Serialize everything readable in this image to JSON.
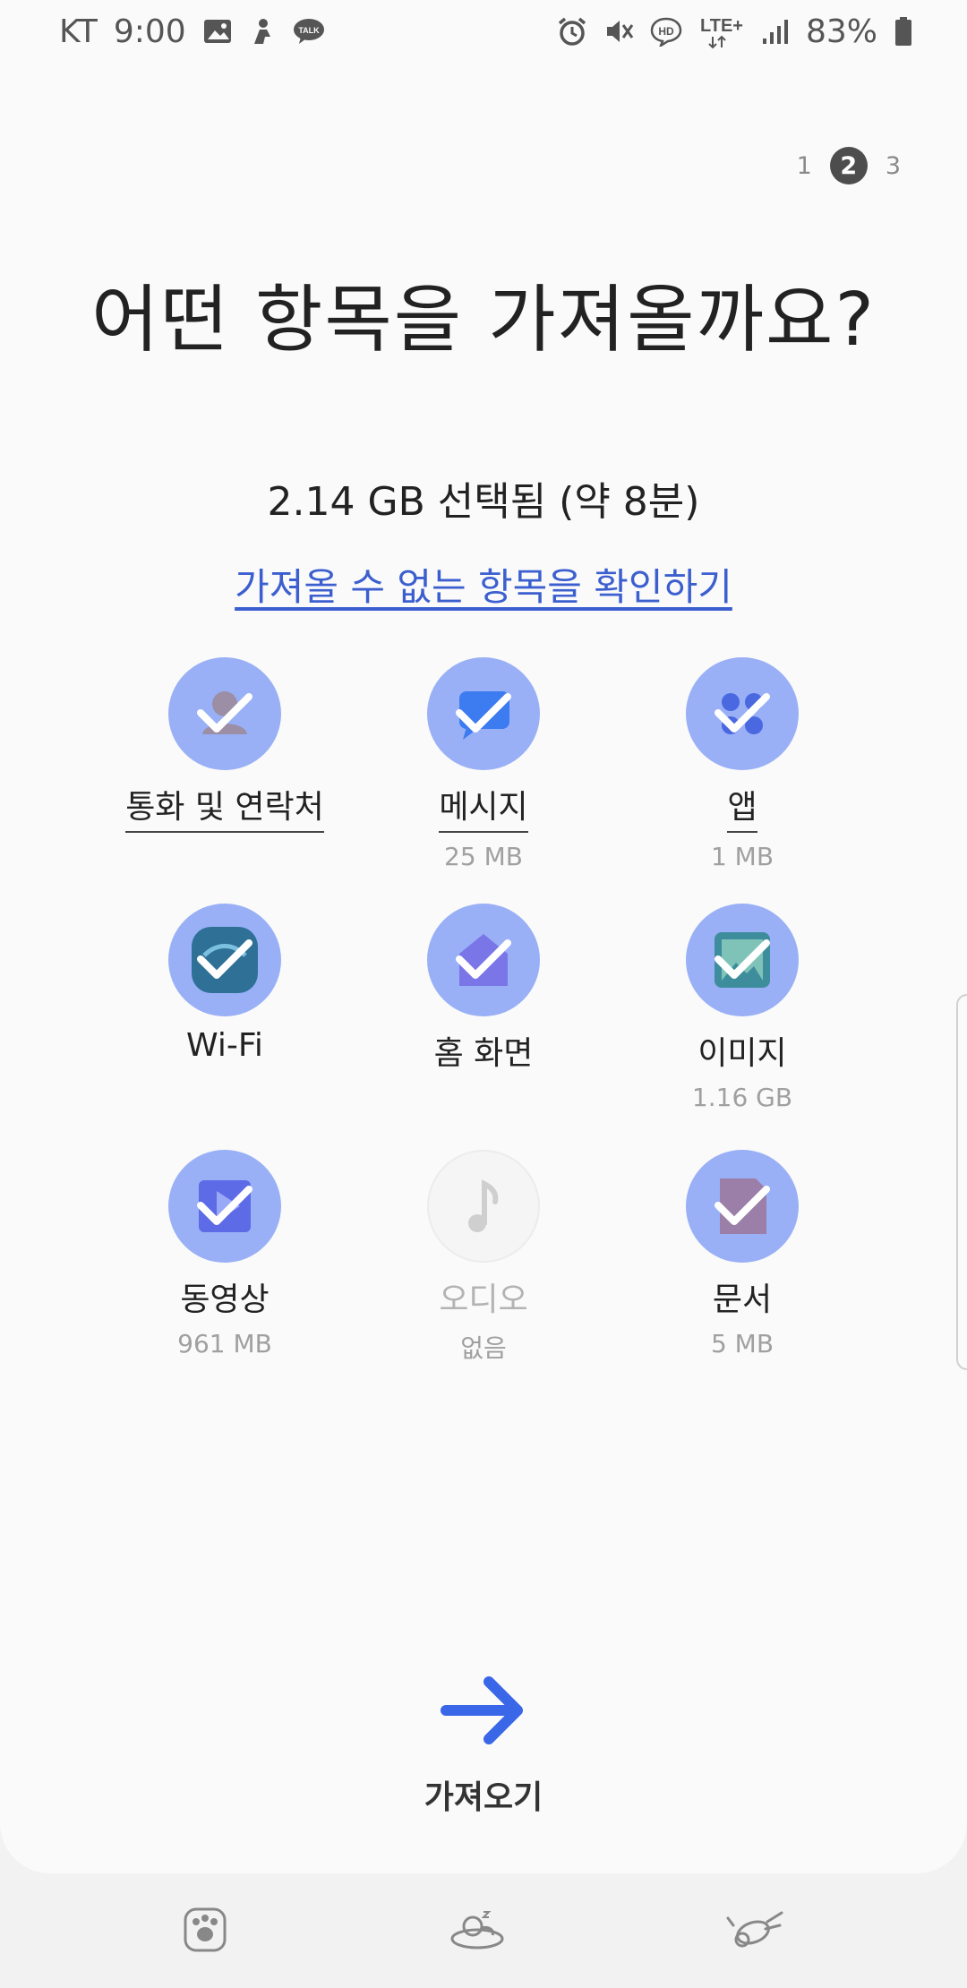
{
  "status_bar": {
    "carrier": "KT",
    "time": "9:00",
    "network": "LTE+",
    "hd_badge": "HD",
    "talk_badge": "TALK",
    "battery": "83%"
  },
  "steps": [
    "1",
    "2",
    "3"
  ],
  "active_step": "2",
  "title": "어떤 항목을 가져올까요?",
  "summary": "2.14 GB 선택됨 (약 8분)",
  "check_link": "가져올 수 없는 항목을 확인하기",
  "items": [
    {
      "label": "통화 및 연락처",
      "size": "",
      "icon": "contacts-icon",
      "selected": true
    },
    {
      "label": "메시지",
      "size": "25 MB",
      "icon": "message-icon",
      "selected": true
    },
    {
      "label": "앱",
      "size": "1 MB",
      "icon": "apps-icon",
      "selected": true
    },
    {
      "label": "Wi-Fi",
      "size": "",
      "icon": "wifi-icon",
      "selected": true
    },
    {
      "label": "홈 화면",
      "size": "",
      "icon": "home-icon",
      "selected": true
    },
    {
      "label": "이미지",
      "size": "1.16 GB",
      "icon": "image-icon",
      "selected": true
    },
    {
      "label": "동영상",
      "size": "961 MB",
      "icon": "video-icon",
      "selected": true
    },
    {
      "label": "오디오",
      "size": "없음",
      "icon": "music-icon",
      "selected": false
    },
    {
      "label": "문서",
      "size": "5 MB",
      "icon": "document-icon",
      "selected": true
    }
  ],
  "import_button": {
    "label": "가져오기",
    "icon": "arrow-right-icon"
  },
  "bottom_nav": [
    "paw-icon",
    "sleeping-pet-icon",
    "flying-pet-icon"
  ],
  "colors": {
    "accent": "#3c5fcf",
    "circle": "#99b0f6",
    "arrow": "#3a66e8"
  }
}
